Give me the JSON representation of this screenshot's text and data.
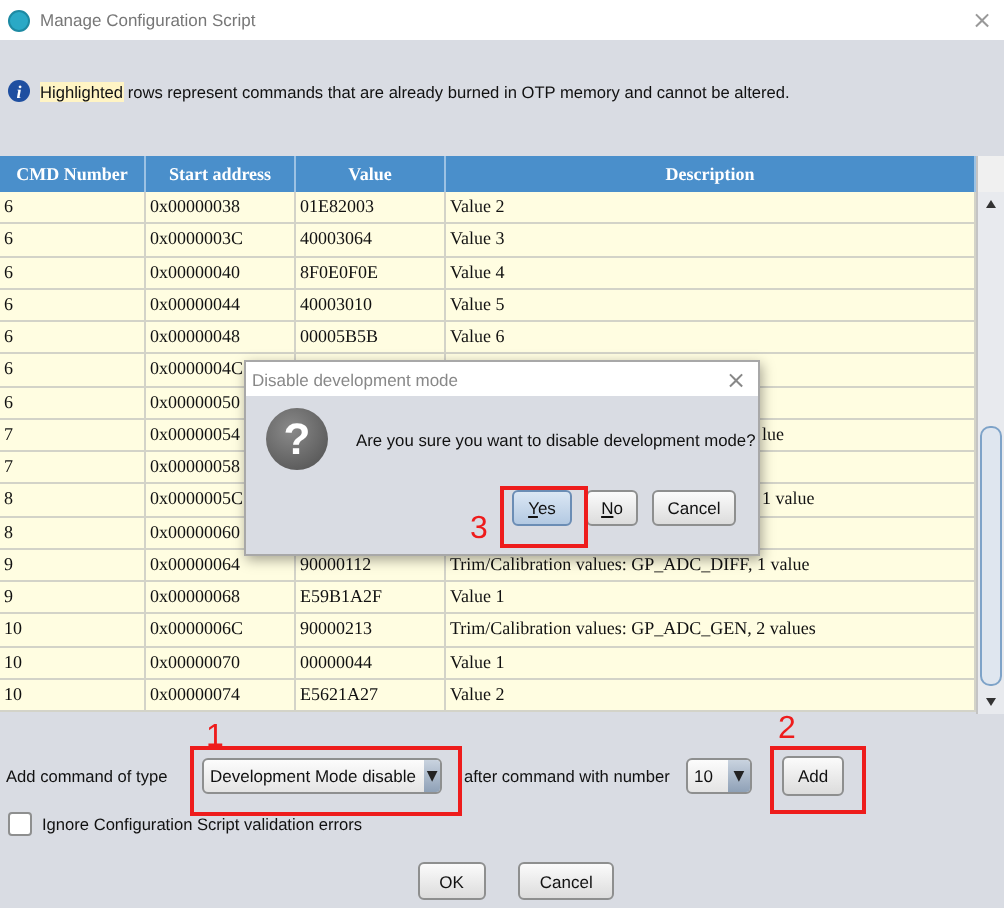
{
  "window": {
    "title": "Manage Configuration Script",
    "close": "×"
  },
  "notice": {
    "icon": "i",
    "highlighted": "Highlighted",
    "text": " rows represent commands that are already burned in OTP memory and cannot be altered."
  },
  "table": {
    "columns": [
      "CMD Number",
      "Start address",
      "Value",
      "Description"
    ],
    "rows": [
      {
        "cmd": "6",
        "address": "0x00000038",
        "value": "01E82003",
        "description": "Value 2",
        "highlighted": true
      },
      {
        "cmd": "6",
        "address": "0x0000003C",
        "value": "40003064",
        "description": "Value 3",
        "highlighted": true
      },
      {
        "cmd": "6",
        "address": "0x00000040",
        "value": "8F0E0F0E",
        "description": "Value 4",
        "highlighted": true
      },
      {
        "cmd": "6",
        "address": "0x00000044",
        "value": "40003010",
        "description": "Value 5",
        "highlighted": true
      },
      {
        "cmd": "6",
        "address": "0x00000048",
        "value": "00005B5B",
        "description": "Value 6",
        "highlighted": true
      },
      {
        "cmd": "6",
        "address": "0x0000004C",
        "highlighted": true
      },
      {
        "cmd": "6",
        "address": "0x00000050",
        "highlighted": true
      },
      {
        "cmd": "7",
        "address": "0x00000054",
        "description": "lue",
        "highlighted": true
      },
      {
        "cmd": "7",
        "address": "0x00000058",
        "highlighted": true
      },
      {
        "cmd": "8",
        "address": "0x0000005C",
        "description": "1 value",
        "highlighted": true
      },
      {
        "cmd": "8",
        "address": "0x00000060",
        "highlighted": true
      },
      {
        "cmd": "9",
        "address": "0x00000064",
        "value": "90000112",
        "description": "Trim/Calibration values: GP_ADC_DIFF, 1 value",
        "highlighted": true
      },
      {
        "cmd": "9",
        "address": "0x00000068",
        "value": "E59B1A2F",
        "description": "Value 1",
        "highlighted": true
      },
      {
        "cmd": "10",
        "address": "0x0000006C",
        "value": "90000213",
        "description": "Trim/Calibration values: GP_ADC_GEN, 2 values",
        "highlighted": true
      },
      {
        "cmd": "10",
        "address": "0x00000070",
        "value": "00000044",
        "description": "Value 1",
        "highlighted": true
      },
      {
        "cmd": "10",
        "address": "0x00000074",
        "value": "E5621A27",
        "description": "Value 2",
        "highlighted": true
      }
    ]
  },
  "add_row": {
    "label": "Add command of type",
    "type_combo": {
      "value": "Development Mode disable",
      "arrow": "▼"
    },
    "after_label": "after command with number",
    "number_combo": {
      "value": "10",
      "arrow": "▼"
    },
    "add_button": "Add"
  },
  "ignore_checkbox": {
    "label": "Ignore Configuration Script validation errors",
    "checked": false
  },
  "buttons": [
    "OK",
    "Cancel"
  ],
  "dialog": {
    "title": "Disable development mode",
    "close": "×",
    "icon": "?",
    "message": "Are you sure you want to disable development mode?",
    "buttons": [
      {
        "label": "Yes",
        "mnemonic": true,
        "default": true
      },
      {
        "label": "No",
        "mnemonic": true,
        "default": false
      },
      {
        "label": "Cancel",
        "mnemonic": false,
        "default": false
      }
    ]
  },
  "annotations": [
    {
      "label": "1"
    },
    {
      "label": "2"
    },
    {
      "label": "3"
    }
  ]
}
